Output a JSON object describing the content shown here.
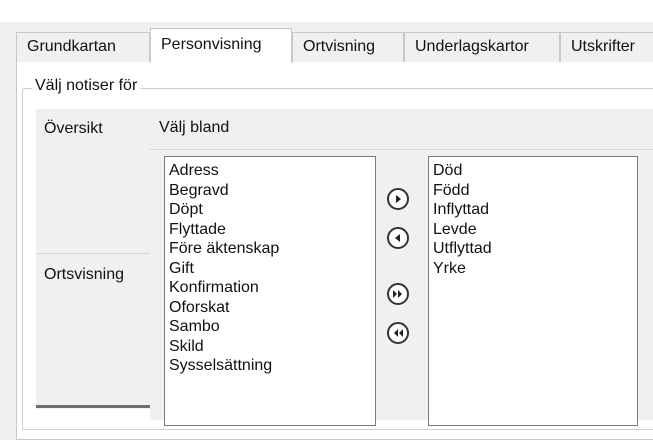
{
  "tabs": [
    {
      "label": "Grundkartan",
      "active": false
    },
    {
      "label": "Personvisning",
      "active": true
    },
    {
      "label": "Ortvisning",
      "active": false
    },
    {
      "label": "Underlagskartor",
      "active": false
    },
    {
      "label": "Utskrifter",
      "active": false
    }
  ],
  "group": {
    "legend": "Välj notiser för"
  },
  "nav": {
    "items": [
      "Översikt",
      "Ortsvisning"
    ]
  },
  "content": {
    "header": "Välj bland"
  },
  "available_list": [
    "Adress",
    "Begravd",
    "Döpt",
    "Flyttade",
    "Före äktenskap",
    "Gift",
    "Konfirmation",
    "Oforskat",
    "Sambo",
    "Skild",
    "Sysselsättning"
  ],
  "selected_list": [
    "Död",
    "Född",
    "Inflyttad",
    "Levde",
    "Utflyttad",
    "Yrke"
  ],
  "buttons": [
    {
      "name": "add-selected-button",
      "icon": "arrow-right-icon"
    },
    {
      "name": "remove-selected-button",
      "icon": "arrow-left-icon"
    },
    {
      "name": "add-all-button",
      "icon": "double-arrow-right-icon"
    },
    {
      "name": "remove-all-button",
      "icon": "double-arrow-left-icon"
    }
  ]
}
